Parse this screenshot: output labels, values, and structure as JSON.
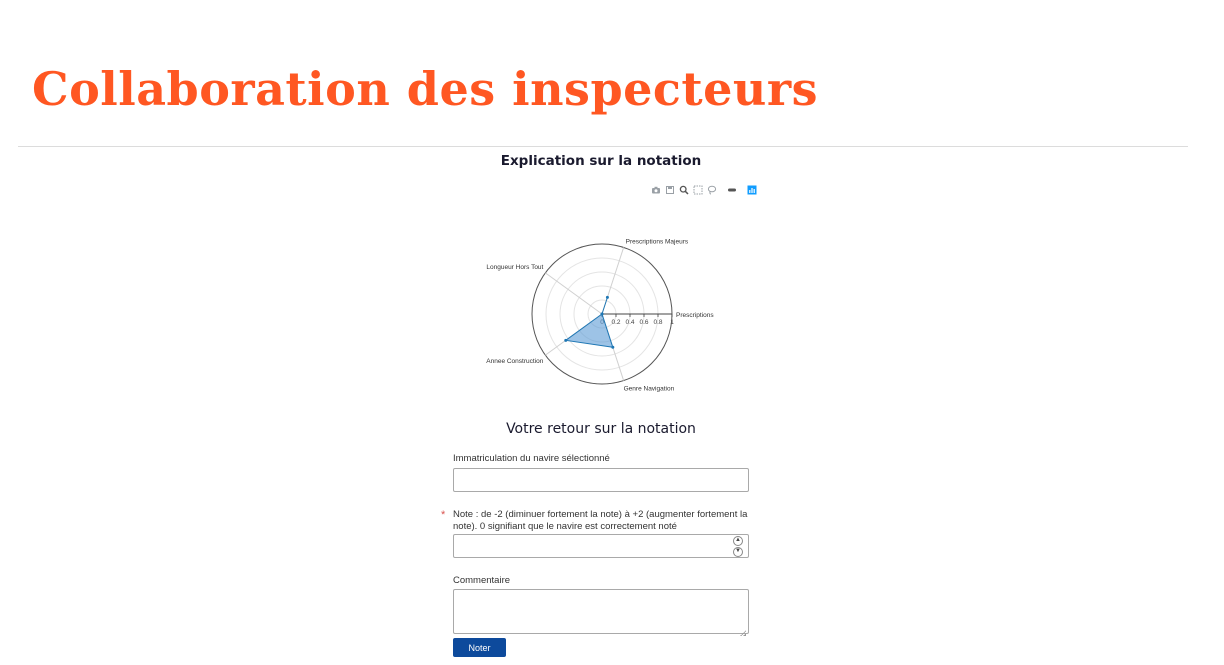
{
  "page": {
    "title": "Collaboration des inspecteurs"
  },
  "chart_section": {
    "title": "Explication sur la notation",
    "toolbar": [
      "camera-icon",
      "save-icon",
      "zoom-icon",
      "select-box-icon",
      "lasso-icon",
      "pan-icon",
      "plotly-logo-icon"
    ]
  },
  "chart_data": {
    "type": "radar",
    "axes": [
      "Prescriptions",
      "Prescriptions Majeurs",
      "Longueur Hors Tout",
      "Annee Construction",
      "Genre Navigation"
    ],
    "radial_ticks": [
      "0",
      "0.2",
      "0.4",
      "0.6",
      "0.8",
      "1"
    ],
    "series": [
      {
        "values": [
          0.0,
          0.25,
          0.0,
          0.64,
          0.5
        ]
      }
    ],
    "rlim": [
      0,
      1
    ],
    "color": "#1f77b4",
    "fill_color": "#5b9bd5"
  },
  "feedback": {
    "title": "Votre retour sur la notation",
    "immat_label": "Immatriculation du navire sélectionné",
    "immat_value": "",
    "note_label": "Note : de -2 (diminuer fortement la note) à +2 (augmenter fortement la note). 0 signifiant que le navire est correctement noté",
    "note_required_mark": "*",
    "note_value": "",
    "comment_label": "Commentaire",
    "comment_value": "",
    "submit_label": "Noter"
  }
}
